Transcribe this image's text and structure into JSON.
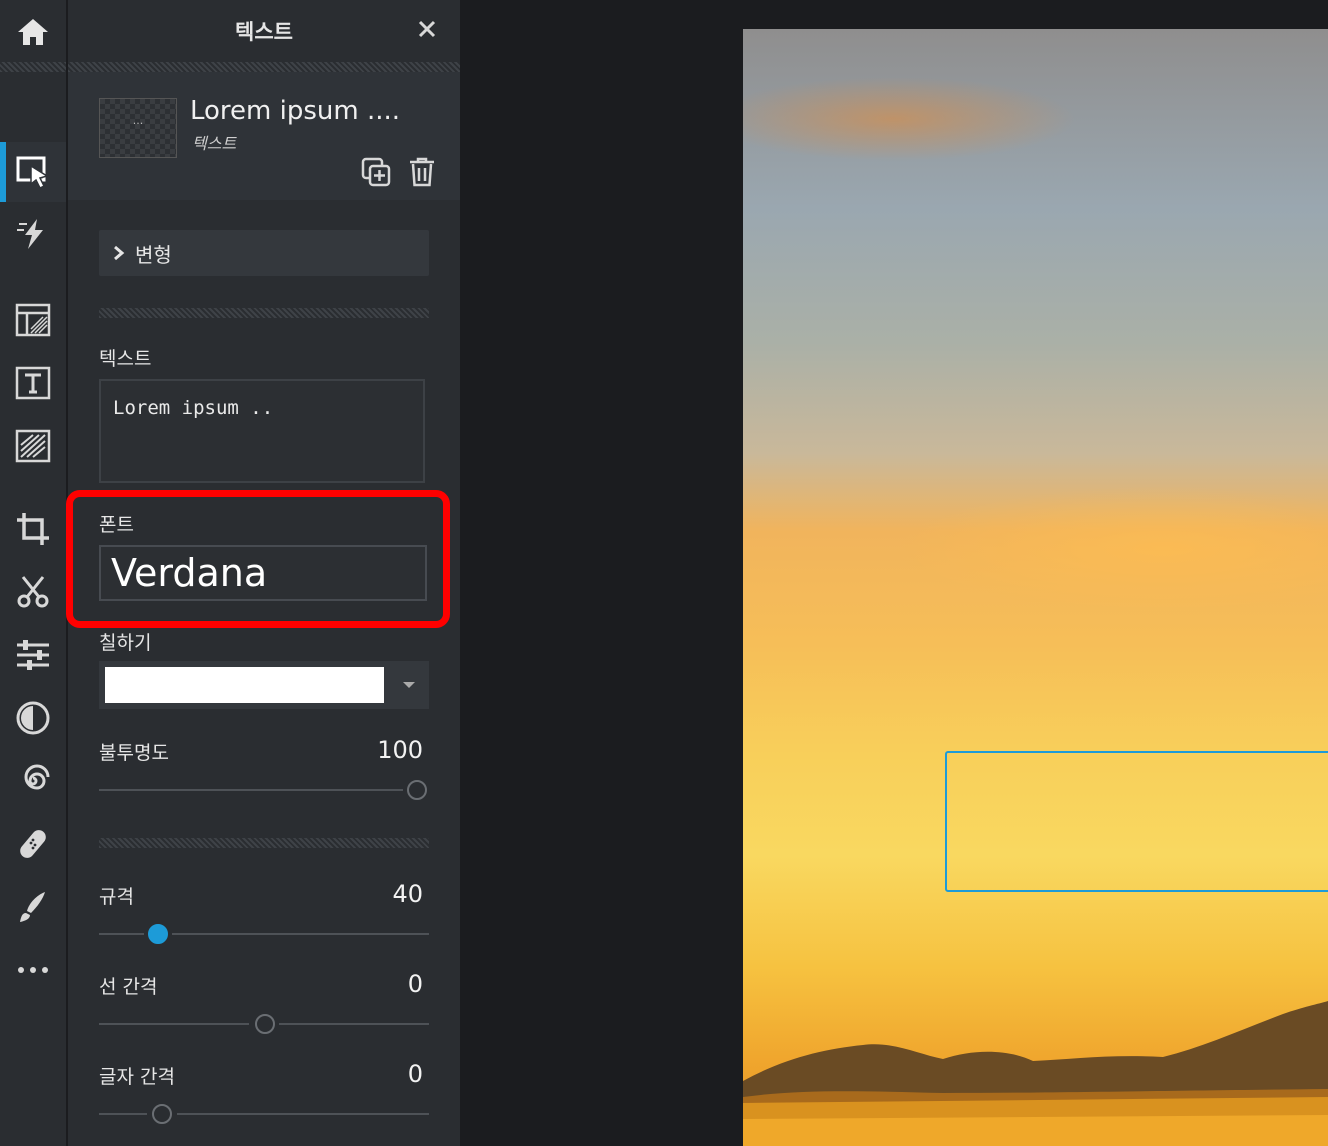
{
  "panel": {
    "title": "텍스트",
    "layer": {
      "name": "Lorem ipsum ....",
      "type": "텍스트",
      "thumb_text": "···"
    },
    "transform_label": "변형",
    "text_label": "텍스트",
    "text_value": "Lorem ipsum ..",
    "font_label": "폰트",
    "font_value": "Verdana",
    "fill_label": "칠하기",
    "fill_color": "#ffffff",
    "opacity_label": "불투명도",
    "opacity_value": "100",
    "size_label": "규격",
    "size_value": "40",
    "line_spacing_label": "선 간격",
    "line_spacing_value": "0",
    "letter_spacing_label": "글자 간격",
    "letter_spacing_value": "0"
  },
  "rail_icons": [
    "home-icon",
    "select-icon",
    "magic-icon",
    "layout-icon",
    "text-icon",
    "texture-icon",
    "crop-icon",
    "cut-icon",
    "adjust-icon",
    "filter-icon",
    "swirl-icon",
    "bandage-icon",
    "brush-icon",
    "more-icon"
  ],
  "colors": {
    "accent": "#1d9bd8",
    "highlight": "#ff0000"
  }
}
